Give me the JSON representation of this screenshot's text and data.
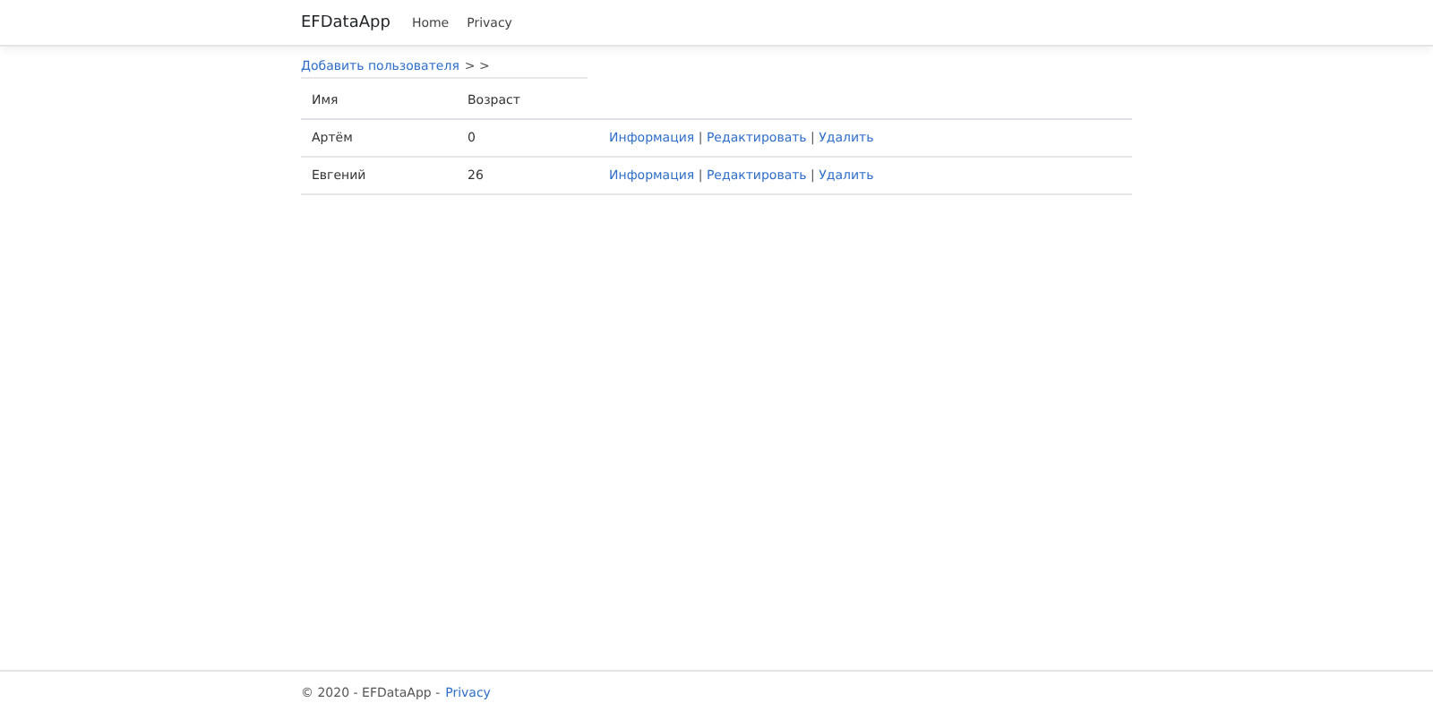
{
  "navbar": {
    "brand": "EFDataApp",
    "links": [
      "Home",
      "Privacy"
    ]
  },
  "breadcrumb": {
    "link": "Добавить пользователя",
    "trail": "> >"
  },
  "table": {
    "columns": [
      "Имя",
      "Возраст"
    ],
    "rows": [
      {
        "name": "Артём",
        "age": "0",
        "actions": [
          "Информация",
          "Редактировать",
          "Удалить"
        ],
        "separator": "|"
      },
      {
        "name": "Евгений",
        "age": "26",
        "actions": [
          "Информация",
          "Редактировать",
          "Удалить"
        ],
        "separator": "|"
      }
    ]
  },
  "footer": {
    "text": "© 2020 - EFDataApp -",
    "link": "Privacy"
  }
}
